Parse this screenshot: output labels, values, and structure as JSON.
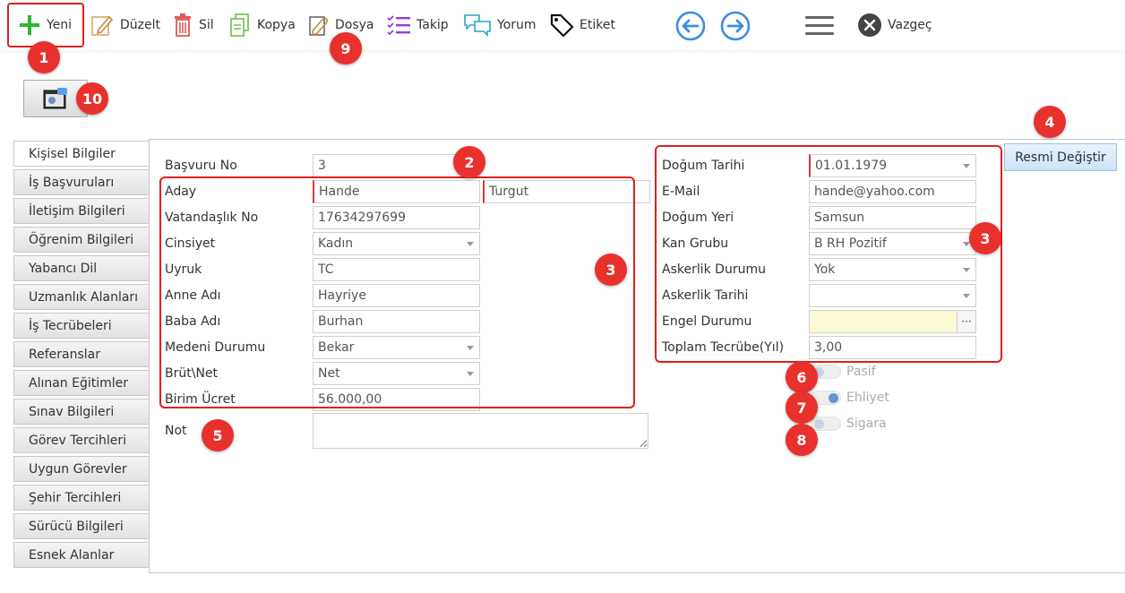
{
  "toolbar": {
    "new": "Yeni",
    "edit": "Düzelt",
    "delete": "Sil",
    "copy": "Kopya",
    "file": "Dosya",
    "follow": "Takip",
    "comment": "Yorum",
    "tag": "Etiket",
    "cancel": "Vazgeç"
  },
  "icons": {
    "new": "plus-icon",
    "edit": "pencil-icon",
    "delete": "trash-icon",
    "copy": "copy-icon",
    "file": "paperclip-icon",
    "follow": "checklist-icon",
    "comment": "chat-icon",
    "tag": "tag-icon",
    "prev": "arrow-left-icon",
    "next": "arrow-right-icon",
    "menu": "hamburger-icon",
    "cancel": "close-icon"
  },
  "colors": {
    "accent": "#3a8ee0",
    "callout": "#e8302d",
    "new_icon": "#2fb52f"
  },
  "tabs": [
    "Kişisel Bilgiler",
    "İş Başvuruları",
    "İletişim Bilgileri",
    "Öğrenim Bilgileri",
    "Yabancı Dil",
    "Uzmanlık Alanları",
    "İş Tecrübeleri",
    "Referanslar",
    "Alınan Eğitimler",
    "Sınav Bilgileri",
    "Görev Tercihleri",
    "Uygun Görevler",
    "Şehir Tercihleri",
    "Sürücü Bilgileri",
    "Esnek Alanlar"
  ],
  "left_form": {
    "application_no": {
      "label": "Başvuru No",
      "value": "3"
    },
    "candidate": {
      "label": "Aday",
      "first": "Hande",
      "last": "Turgut"
    },
    "citizenship_no": {
      "label": "Vatandaşlık No",
      "value": "17634297699"
    },
    "gender": {
      "label": "Cinsiyet",
      "value": "Kadın"
    },
    "nationality": {
      "label": "Uyruk",
      "value": "TC"
    },
    "mother": {
      "label": "Anne Adı",
      "value": "Hayriye"
    },
    "father": {
      "label": "Baba Adı",
      "value": "Burhan"
    },
    "marital": {
      "label": "Medeni Durumu",
      "value": "Bekar"
    },
    "gross_net": {
      "label": "Brüt\\Net",
      "value": "Net"
    },
    "unit_fee": {
      "label": "Birim Ücret",
      "value": "56.000,00"
    },
    "note": {
      "label": "Not"
    }
  },
  "right_form": {
    "birth_date": {
      "label": "Doğum Tarihi",
      "value": "01.01.1979"
    },
    "email": {
      "label": "E-Mail",
      "value": "hande@yahoo.com"
    },
    "birth_place": {
      "label": "Doğum Yeri",
      "value": "Samsun"
    },
    "blood": {
      "label": "Kan Grubu",
      "value": "B RH Pozitif"
    },
    "military": {
      "label": "Askerlik Durumu",
      "value": "Yok"
    },
    "military_date": {
      "label": "Askerlik Tarihi",
      "value": ""
    },
    "disability": {
      "label": "Engel Durumu",
      "value": "",
      "dots": "···"
    },
    "experience": {
      "label": "Toplam Tecrübe(Yıl)",
      "value": "3,00"
    }
  },
  "change_photo": "Resmi Değiştir",
  "toggles": {
    "passive": {
      "label": "Pasif",
      "on": false
    },
    "license": {
      "label": "Ehliyet",
      "on": true
    },
    "smoking": {
      "label": "Sigara",
      "on": false
    }
  },
  "callouts": [
    "1",
    "2",
    "3",
    "3",
    "4",
    "5",
    "6",
    "7",
    "8",
    "9",
    "10"
  ]
}
